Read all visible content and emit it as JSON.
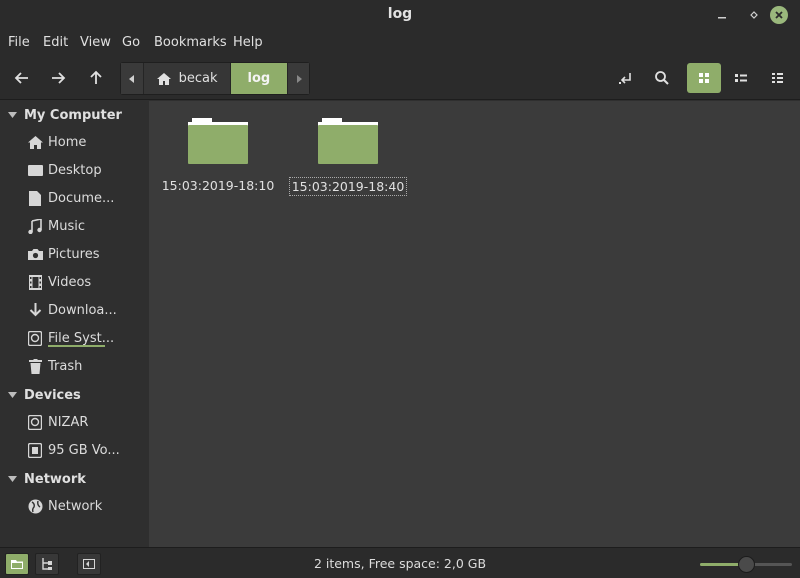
{
  "window": {
    "title": "log"
  },
  "menu": [
    "File",
    "Edit",
    "View",
    "Go",
    "Bookmarks",
    "Help"
  ],
  "breadcrumb": [
    "becak",
    "log"
  ],
  "sidebar": {
    "sections": [
      {
        "title": "My Computer",
        "items": [
          "Home",
          "Desktop",
          "Docume...",
          "Music",
          "Pictures",
          "Videos",
          "Downloa...",
          "File Syst...",
          "Trash"
        ]
      },
      {
        "title": "Devices",
        "items": [
          "NIZAR",
          "95 GB Vo..."
        ]
      },
      {
        "title": "Network",
        "items": [
          "Network"
        ]
      }
    ],
    "filesystem_usage": 0.95
  },
  "files": [
    {
      "name": "15:03:2019-18:10",
      "selected": false
    },
    {
      "name": "15:03:2019-18:40",
      "selected": true
    }
  ],
  "status": {
    "text": "2 items, Free space: 2,0 GB"
  },
  "zoom": {
    "level": 0.5
  },
  "colors": {
    "accent": "#8fad6a",
    "folder": "#8fad6a",
    "background": "#3b3b3b"
  },
  "icons": {
    "back": "arrow-left-icon",
    "forward": "arrow-right-icon",
    "up": "arrow-up-icon",
    "toggle_location": "location-toggle-icon",
    "search": "search-icon",
    "icon_view": "grid-view-icon",
    "list_view": "list-view-icon",
    "compact_view": "compact-view-icon"
  }
}
